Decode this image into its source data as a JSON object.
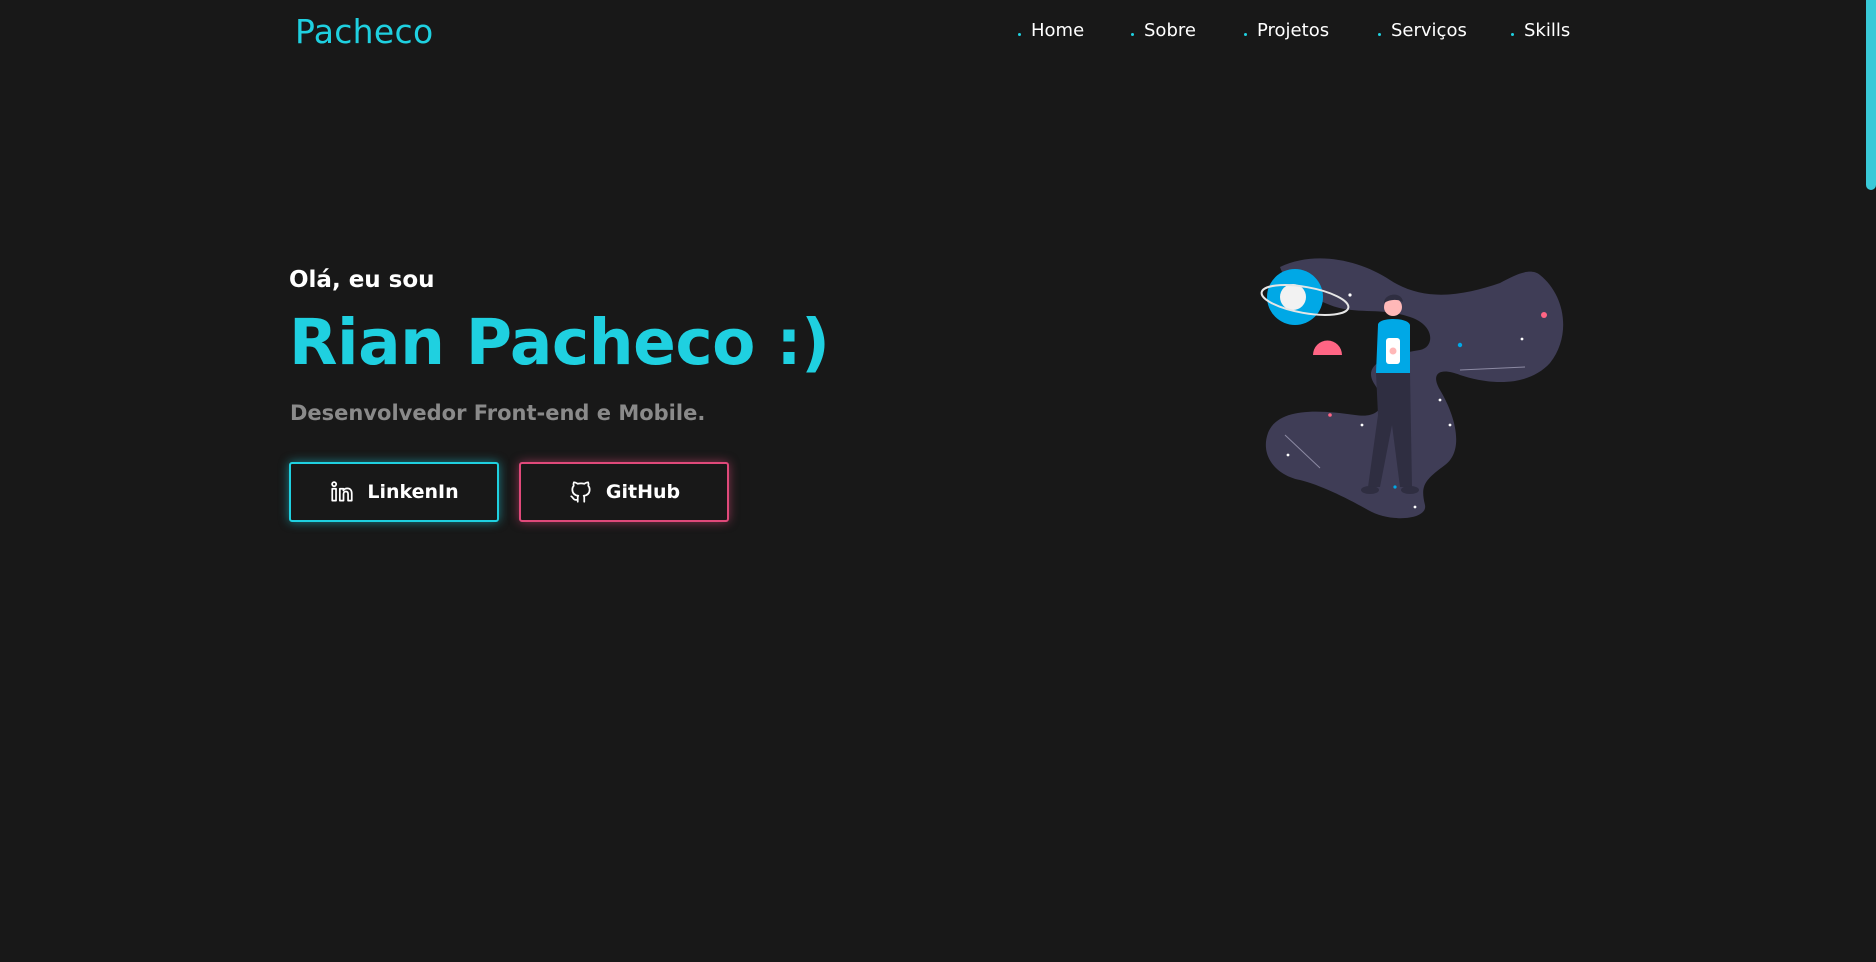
{
  "brand": "Pacheco",
  "nav": {
    "items": [
      {
        "label": "Home"
      },
      {
        "label": "Sobre"
      },
      {
        "label": "Projetos"
      },
      {
        "label": "Serviços"
      },
      {
        "label": "Skills"
      }
    ]
  },
  "hero": {
    "greeting": "Olá, eu sou",
    "name": "Rian Pacheco :)",
    "role": "Desenvolvedor Front-end e Mobile.",
    "buttons": {
      "linkedin": {
        "label": "LinkenIn",
        "icon": "linkedin-icon"
      },
      "github": {
        "label": "GitHub",
        "icon": "github-icon"
      }
    },
    "illustration": "astronaut-space-illustration"
  },
  "colors": {
    "background": "#181818",
    "accent": "#1fd0e0",
    "pink": "#e0497a",
    "muted": "#8a8a8a"
  }
}
